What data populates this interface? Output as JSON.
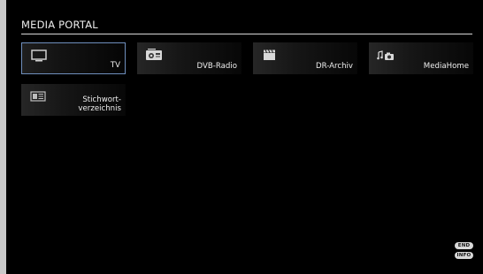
{
  "portal": {
    "title": "MEDIA PORTAL"
  },
  "tiles": [
    {
      "label": "TV",
      "icon": "tv-icon",
      "selected": true
    },
    {
      "label": "DVB-Radio",
      "icon": "radio-icon",
      "selected": false
    },
    {
      "label": "DR-Archiv",
      "icon": "clapperboard-icon",
      "selected": false
    },
    {
      "label": "MediaHome",
      "icon": "media-home-icon",
      "selected": false
    },
    {
      "label_line1": "Stichwort-",
      "label_line2": "verzeichnis",
      "icon": "keyword-index-icon",
      "selected": false
    }
  ],
  "remote_hints": {
    "end": "END",
    "info": "INFO"
  },
  "colors": {
    "background": "#000000",
    "selection_border": "#6f8fbd",
    "text": "#efefef"
  }
}
